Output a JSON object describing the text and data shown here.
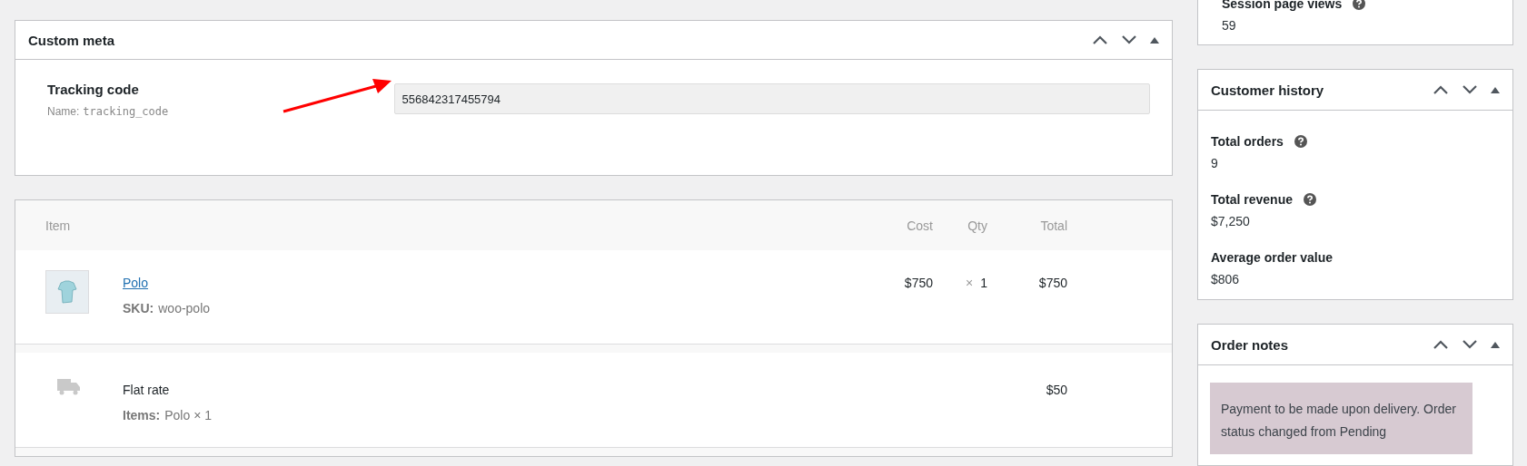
{
  "custom_meta": {
    "title": "Custom meta",
    "field": {
      "label": "Tracking code",
      "name_label": "Name:",
      "name": "tracking_code",
      "value": "556842317455794"
    }
  },
  "order_items": {
    "columns": [
      "Item",
      "Cost",
      "Qty",
      "Total"
    ],
    "rows": [
      {
        "kind": "product",
        "name": "Polo",
        "meta_label": "SKU:",
        "meta": "woo-polo",
        "cost": "$750",
        "qty_sign": "×",
        "qty": "1",
        "total": "$750"
      },
      {
        "kind": "shipping",
        "name": "Flat rate",
        "meta_label": "Items:",
        "meta": "Polo × 1",
        "total": "$50"
      }
    ]
  },
  "session": {
    "label": "Session page views",
    "value": "59"
  },
  "customer_history": {
    "title": "Customer history",
    "stats": [
      {
        "label": "Total orders",
        "help": true,
        "value": "9"
      },
      {
        "label": "Total revenue",
        "help": true,
        "value": "$7,250"
      },
      {
        "label": "Average order value",
        "help": false,
        "value": "$806"
      }
    ]
  },
  "order_notes": {
    "title": "Order notes",
    "notes": [
      {
        "text": "Payment to be made upon delivery. Order status changed from Pending"
      }
    ]
  }
}
